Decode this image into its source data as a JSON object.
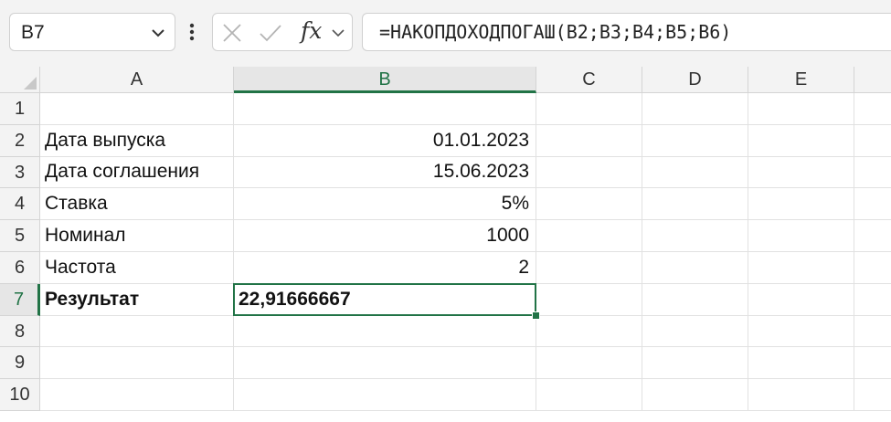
{
  "formula_bar": {
    "name_box": "B7",
    "formula": "=НАКОПДОХОДПОГАШ(B2;B3;B4;B5;B6)",
    "insert_function_label": "fx"
  },
  "columns": [
    "A",
    "B",
    "C",
    "D",
    "E"
  ],
  "selected_column": "B",
  "rows": [
    {
      "num": "1",
      "a": "",
      "b": ""
    },
    {
      "num": "2",
      "a": "Дата выпуска",
      "b": "01.01.2023"
    },
    {
      "num": "3",
      "a": "Дата соглашения",
      "b": "15.06.2023"
    },
    {
      "num": "4",
      "a": "Ставка",
      "b": "5%"
    },
    {
      "num": "5",
      "a": "Номинал",
      "b": "1000"
    },
    {
      "num": "6",
      "a": "Частота",
      "b": "2"
    },
    {
      "num": "7",
      "a": "Результат",
      "b": "22,91666667"
    },
    {
      "num": "8",
      "a": "",
      "b": ""
    },
    {
      "num": "9",
      "a": "",
      "b": ""
    },
    {
      "num": "10",
      "a": "",
      "b": ""
    }
  ],
  "selected_row": "7",
  "accent_color": "#217346"
}
